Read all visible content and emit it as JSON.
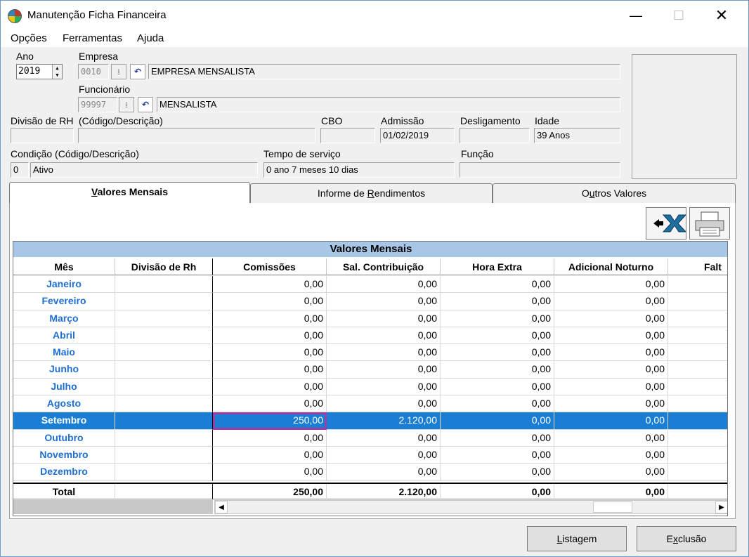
{
  "window": {
    "title": "Manutenção Ficha Financeira",
    "minimize": "—",
    "maximize": "☐",
    "close": "✕"
  },
  "menu": [
    "Opções",
    "Ferramentas",
    "Ajuda"
  ],
  "form": {
    "ano_label": "Ano",
    "ano_value": "2019",
    "empresa_label": "Empresa",
    "empresa_code": "0010",
    "empresa_name": "EMPRESA MENSALISTA",
    "funcionario_label": "Funcionário",
    "funcionario_code": "99997",
    "funcionario_name": "MENSALISTA",
    "divisao_label": "Divisão de RH",
    "divisao_desc_label": "(Código/Descrição)",
    "cbo_label": "CBO",
    "admissao_label": "Admissão",
    "admissao_value": "01/02/2019",
    "desligamento_label": "Desligamento",
    "idade_label": "Idade",
    "idade_value": "39 Anos",
    "condicao_label": "Condição (Código/Descrição)",
    "condicao_code": "0",
    "condicao_desc": "Ativo",
    "tempo_label": "Tempo de serviço",
    "tempo_value": "0 ano 7 meses 10 dias",
    "funcao_label": "Função"
  },
  "tabs": [
    {
      "pre": "",
      "u": "V",
      "post": "alores Mensais"
    },
    {
      "pre": "Informe de ",
      "u": "R",
      "post": "endimentos"
    },
    {
      "pre": "O",
      "u": "u",
      "post": "tros Valores"
    }
  ],
  "grid": {
    "banner": "Valores Mensais",
    "columns": [
      "Mês",
      "Divisão de Rh",
      "Comissões",
      "Sal. Contribuição",
      "Hora Extra",
      "Adicional Noturno",
      "Falt"
    ],
    "rows": [
      {
        "mes": "Janeiro",
        "div": "",
        "comissoes": "0,00",
        "sal": "0,00",
        "hora": "0,00",
        "adic": "0,00"
      },
      {
        "mes": "Fevereiro",
        "div": "",
        "comissoes": "0,00",
        "sal": "0,00",
        "hora": "0,00",
        "adic": "0,00"
      },
      {
        "mes": "Março",
        "div": "",
        "comissoes": "0,00",
        "sal": "0,00",
        "hora": "0,00",
        "adic": "0,00"
      },
      {
        "mes": "Abril",
        "div": "",
        "comissoes": "0,00",
        "sal": "0,00",
        "hora": "0,00",
        "adic": "0,00"
      },
      {
        "mes": "Maio",
        "div": "",
        "comissoes": "0,00",
        "sal": "0,00",
        "hora": "0,00",
        "adic": "0,00"
      },
      {
        "mes": "Junho",
        "div": "",
        "comissoes": "0,00",
        "sal": "0,00",
        "hora": "0,00",
        "adic": "0,00"
      },
      {
        "mes": "Julho",
        "div": "",
        "comissoes": "0,00",
        "sal": "0,00",
        "hora": "0,00",
        "adic": "0,00"
      },
      {
        "mes": "Agosto",
        "div": "",
        "comissoes": "0,00",
        "sal": "0,00",
        "hora": "0,00",
        "adic": "0,00"
      },
      {
        "mes": "Setembro",
        "div": "",
        "comissoes": "250,00",
        "sal": "2.120,00",
        "hora": "0,00",
        "adic": "0,00",
        "selected": true
      },
      {
        "mes": "Outubro",
        "div": "",
        "comissoes": "0,00",
        "sal": "0,00",
        "hora": "0,00",
        "adic": "0,00"
      },
      {
        "mes": "Novembro",
        "div": "",
        "comissoes": "0,00",
        "sal": "0,00",
        "hora": "0,00",
        "adic": "0,00"
      },
      {
        "mes": "Dezembro",
        "div": "",
        "comissoes": "0,00",
        "sal": "0,00",
        "hora": "0,00",
        "adic": "0,00"
      }
    ],
    "total": {
      "mes": "Total",
      "div": "",
      "comissoes": "250,00",
      "sal": "2.120,00",
      "hora": "0,00",
      "adic": "0,00"
    },
    "scroll_left": "◀",
    "scroll_right": "▶"
  },
  "toolbar": {
    "excel_icon": "excel-export-icon",
    "printer_icon": "printer-icon"
  },
  "buttons": [
    {
      "pre": "",
      "u": "L",
      "post": "istagem"
    },
    {
      "pre": "E",
      "u": "x",
      "post": "clusão"
    }
  ],
  "colors": {
    "selected_row": "#1a7fd4",
    "month_text": "#1f6fd1",
    "banner": "#a8c6e6",
    "focus": "#9b3fa8"
  }
}
